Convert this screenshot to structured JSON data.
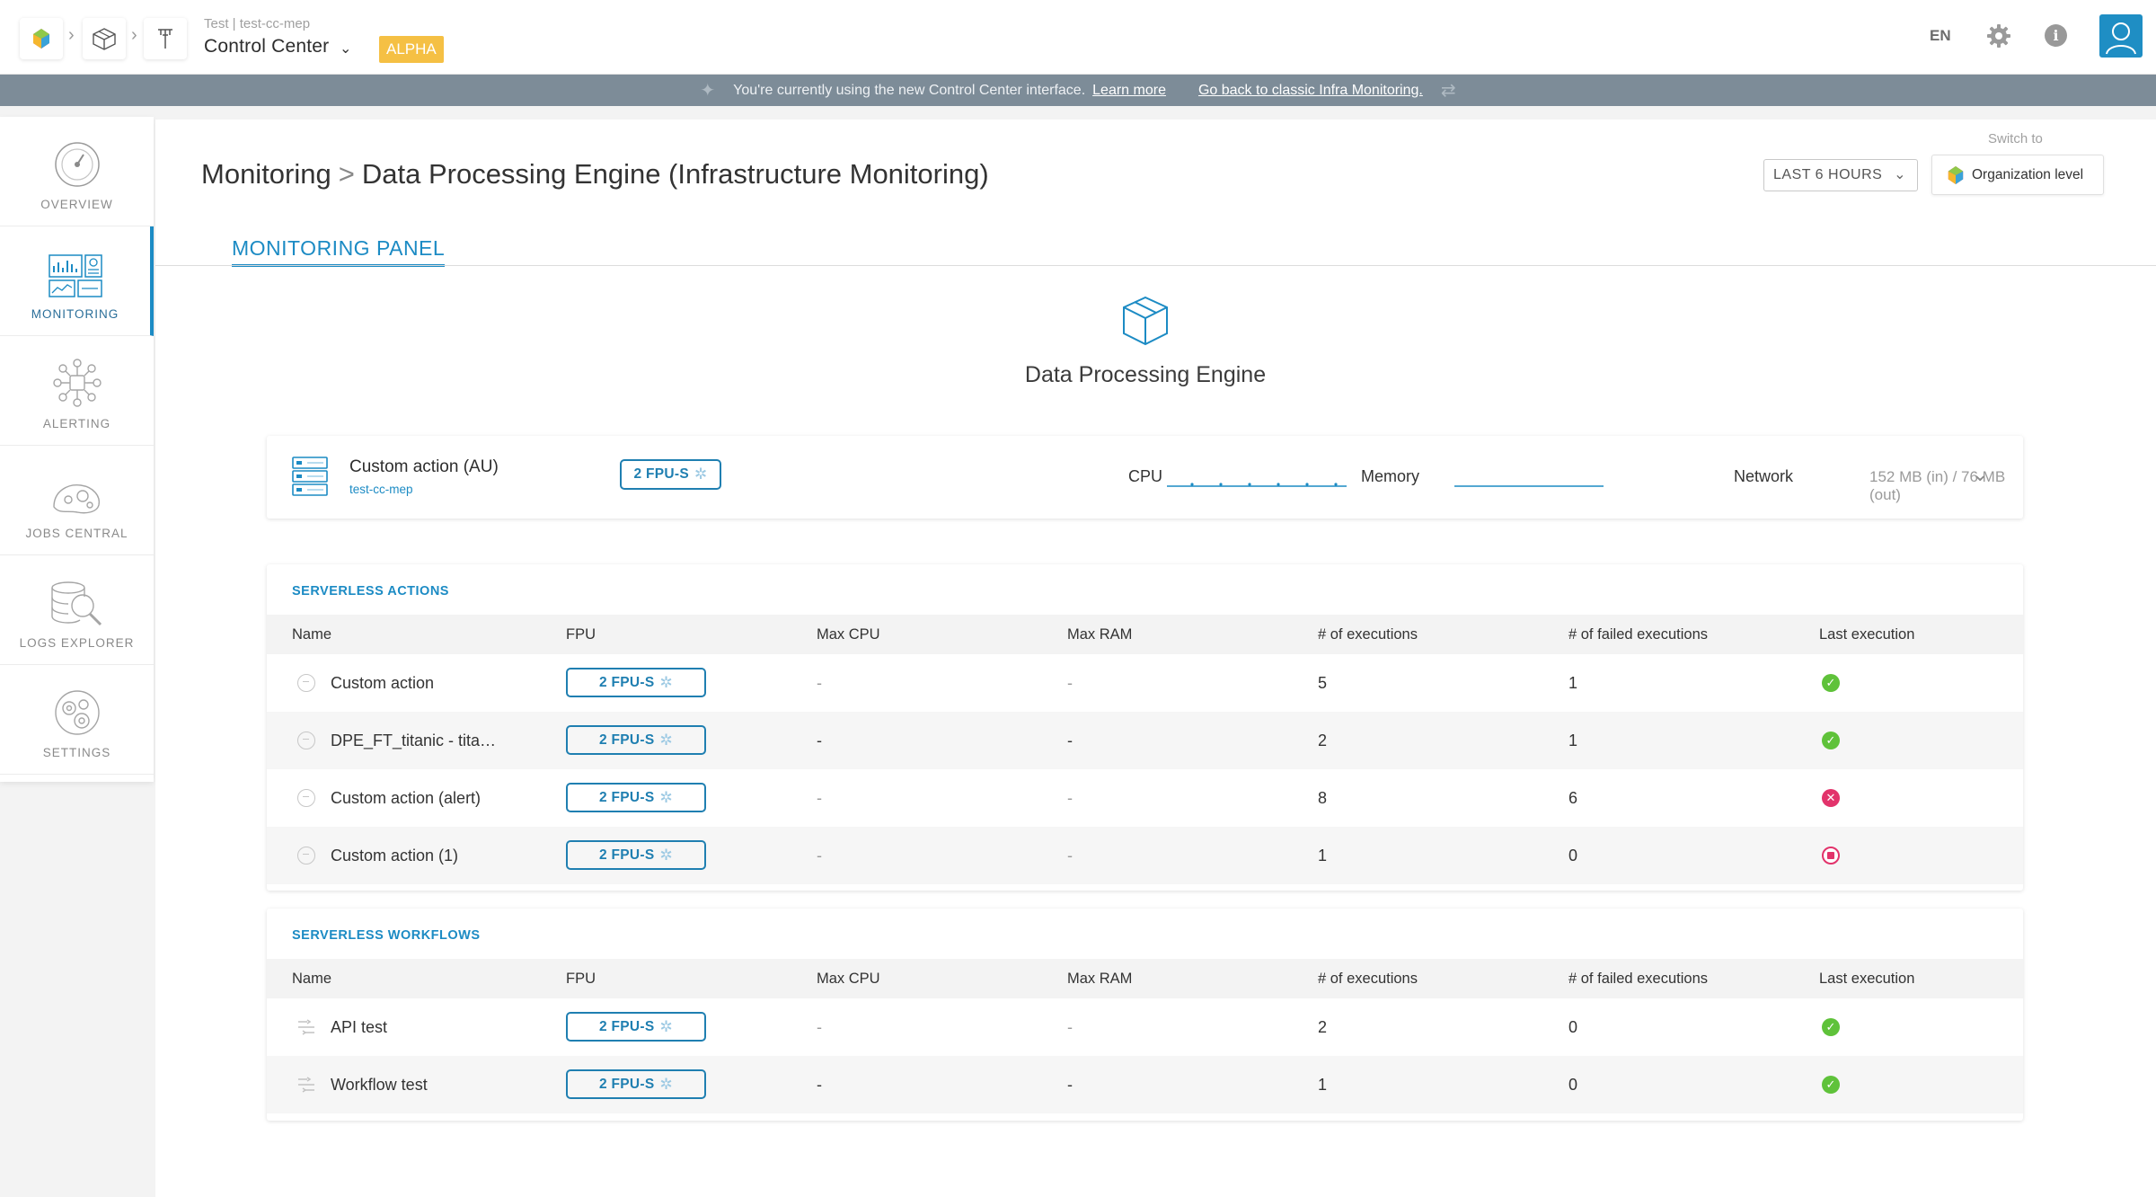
{
  "topbar": {
    "project_sub": "Test | test-cc-mep",
    "project_title": "Control Center",
    "badge": "ALPHA",
    "language": "EN",
    "icons": [
      "app-logo-icon",
      "box-icon",
      "tools-icon",
      "gear-icon",
      "info-icon",
      "user-icon"
    ]
  },
  "banner": {
    "message": "You're currently using the new Control Center interface.",
    "learn_more": "Learn more",
    "go_back": "Go back to classic Infra Monitoring."
  },
  "sidebar": {
    "items": [
      {
        "label": "OVERVIEW",
        "icon": "speedometer-icon",
        "active": false
      },
      {
        "label": "MONITORING",
        "icon": "monitoring-dashboard-icon",
        "active": true
      },
      {
        "label": "ALERTING",
        "icon": "alert-network-icon",
        "active": false
      },
      {
        "label": "JOBS CENTRAL",
        "icon": "jobs-icon",
        "active": false
      },
      {
        "label": "LOGS EXPLORER",
        "icon": "logs-search-icon",
        "active": false
      },
      {
        "label": "SETTINGS",
        "icon": "settings-icon",
        "active": false
      }
    ]
  },
  "header": {
    "breadcrumb_root": "Monitoring",
    "breadcrumb_page": "Data Processing Engine (Infrastructure Monitoring)",
    "time_range": "LAST 6 HOURS",
    "switch_label": "Switch to",
    "org_level": "Organization level",
    "tab": "MONITORING PANEL"
  },
  "hero": {
    "title": "Data Processing Engine"
  },
  "resource": {
    "name": "Custom action (AU)",
    "project": "test-cc-mep",
    "fpu": "2 FPU-S",
    "cpu_label": "CPU",
    "memory_label": "Memory",
    "network_label": "Network",
    "network_value": "152 MB (in) / 76 MB (out)"
  },
  "actions": {
    "title": "SERVERLESS ACTIONS",
    "columns": [
      "Name",
      "FPU",
      "Max CPU",
      "Max RAM",
      "# of executions",
      "# of failed executions",
      "Last execution"
    ],
    "rows": [
      {
        "name": "Custom action",
        "fpu": "2 FPU-S",
        "max_cpu": "-",
        "max_ram": "-",
        "executions": "5",
        "failed": "1",
        "status": "success"
      },
      {
        "name": "DPE_FT_titanic - tita…",
        "fpu": "2 FPU-S",
        "max_cpu": "-",
        "max_ram": "-",
        "executions": "2",
        "failed": "1",
        "status": "success"
      },
      {
        "name": "Custom action (alert)",
        "fpu": "2 FPU-S",
        "max_cpu": "-",
        "max_ram": "-",
        "executions": "8",
        "failed": "6",
        "status": "failed"
      },
      {
        "name": "Custom action (1)",
        "fpu": "2 FPU-S",
        "max_cpu": "-",
        "max_ram": "-",
        "executions": "1",
        "failed": "0",
        "status": "stopped"
      }
    ]
  },
  "workflows": {
    "title": "SERVERLESS WORKFLOWS",
    "columns": [
      "Name",
      "FPU",
      "Max CPU",
      "Max RAM",
      "# of executions",
      "# of failed executions",
      "Last execution"
    ],
    "rows": [
      {
        "name": "API test",
        "fpu": "2 FPU-S",
        "max_cpu": "-",
        "max_ram": "-",
        "executions": "2",
        "failed": "0",
        "status": "success"
      },
      {
        "name": "Workflow test",
        "fpu": "2 FPU-S",
        "max_cpu": "-",
        "max_ram": "-",
        "executions": "1",
        "failed": "0",
        "status": "success"
      }
    ]
  },
  "colors": {
    "accent": "#1c8bc4",
    "alpha_badge": "#f5c044",
    "banner": "#7d8c98",
    "success": "#5fc23a",
    "failure": "#e2336b"
  }
}
